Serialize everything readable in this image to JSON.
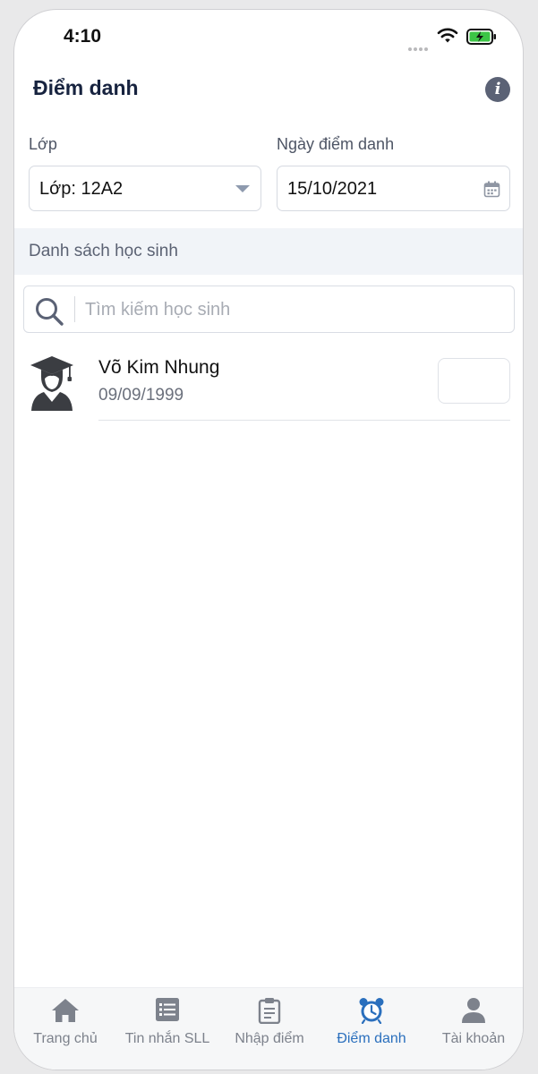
{
  "status_bar": {
    "time": "4:10"
  },
  "header": {
    "title": "Điểm danh",
    "info_icon": "info-icon"
  },
  "filters": {
    "class_label": "Lớp",
    "class_value": "Lớp: 12A2",
    "date_label": "Ngày điểm danh",
    "date_value": "15/10/2021"
  },
  "section": {
    "title": "Danh sách học sinh"
  },
  "search": {
    "placeholder": "Tìm kiếm học sinh",
    "value": ""
  },
  "students": [
    {
      "name": "Võ Kim Nhung",
      "dob": "09/09/1999",
      "avatar_icon": "graduate-icon"
    }
  ],
  "tabs": [
    {
      "label": "Trang chủ",
      "icon": "home-icon"
    },
    {
      "label": "Tin nhắn SLL",
      "icon": "message-list-icon"
    },
    {
      "label": "Nhập điểm",
      "icon": "clipboard-icon"
    },
    {
      "label": "Điểm danh",
      "icon": "alarm-clock-icon",
      "active": true
    },
    {
      "label": "Tài khoản",
      "icon": "user-icon"
    }
  ],
  "colors": {
    "accent": "#2a6fbd",
    "title": "#17233f",
    "section_bg": "#f1f4f8",
    "battery": "#3cc546"
  }
}
